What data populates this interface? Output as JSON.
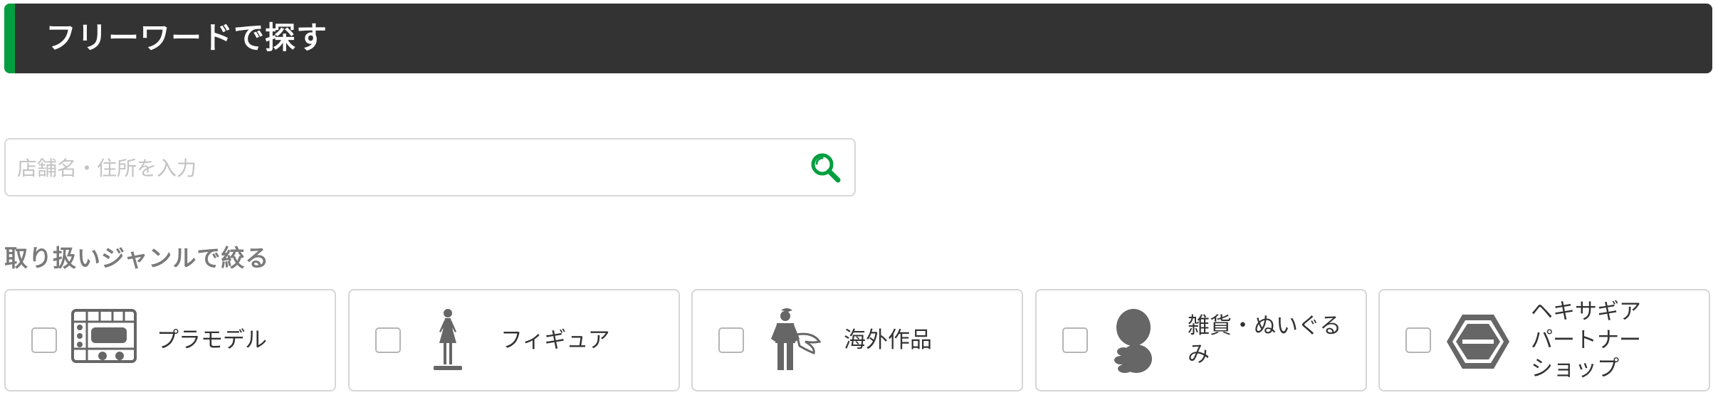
{
  "header": {
    "title": "フリーワードで探す"
  },
  "search": {
    "placeholder": "店舗名・住所を入力",
    "value": ""
  },
  "genre_filter": {
    "heading": "取り扱いジャンルで絞る",
    "items": [
      {
        "label": "プラモデル",
        "icon": "plastic-model-runner-icon",
        "checked": false
      },
      {
        "label": "フィギュア",
        "icon": "figure-icon",
        "checked": false
      },
      {
        "label": "海外作品",
        "icon": "overseas-hero-icon",
        "checked": false
      },
      {
        "label": "雑貨・ぬいぐる\nみ",
        "icon": "plush-doll-icon",
        "checked": false
      },
      {
        "label": "ヘキサギア\nパートナー\nショップ",
        "icon": "hexagear-icon",
        "checked": false
      }
    ]
  },
  "colors": {
    "header_bg": "#333333",
    "accent_green": "#009e3f",
    "icon_gray": "#666666",
    "border_gray": "#d6d6d6"
  }
}
